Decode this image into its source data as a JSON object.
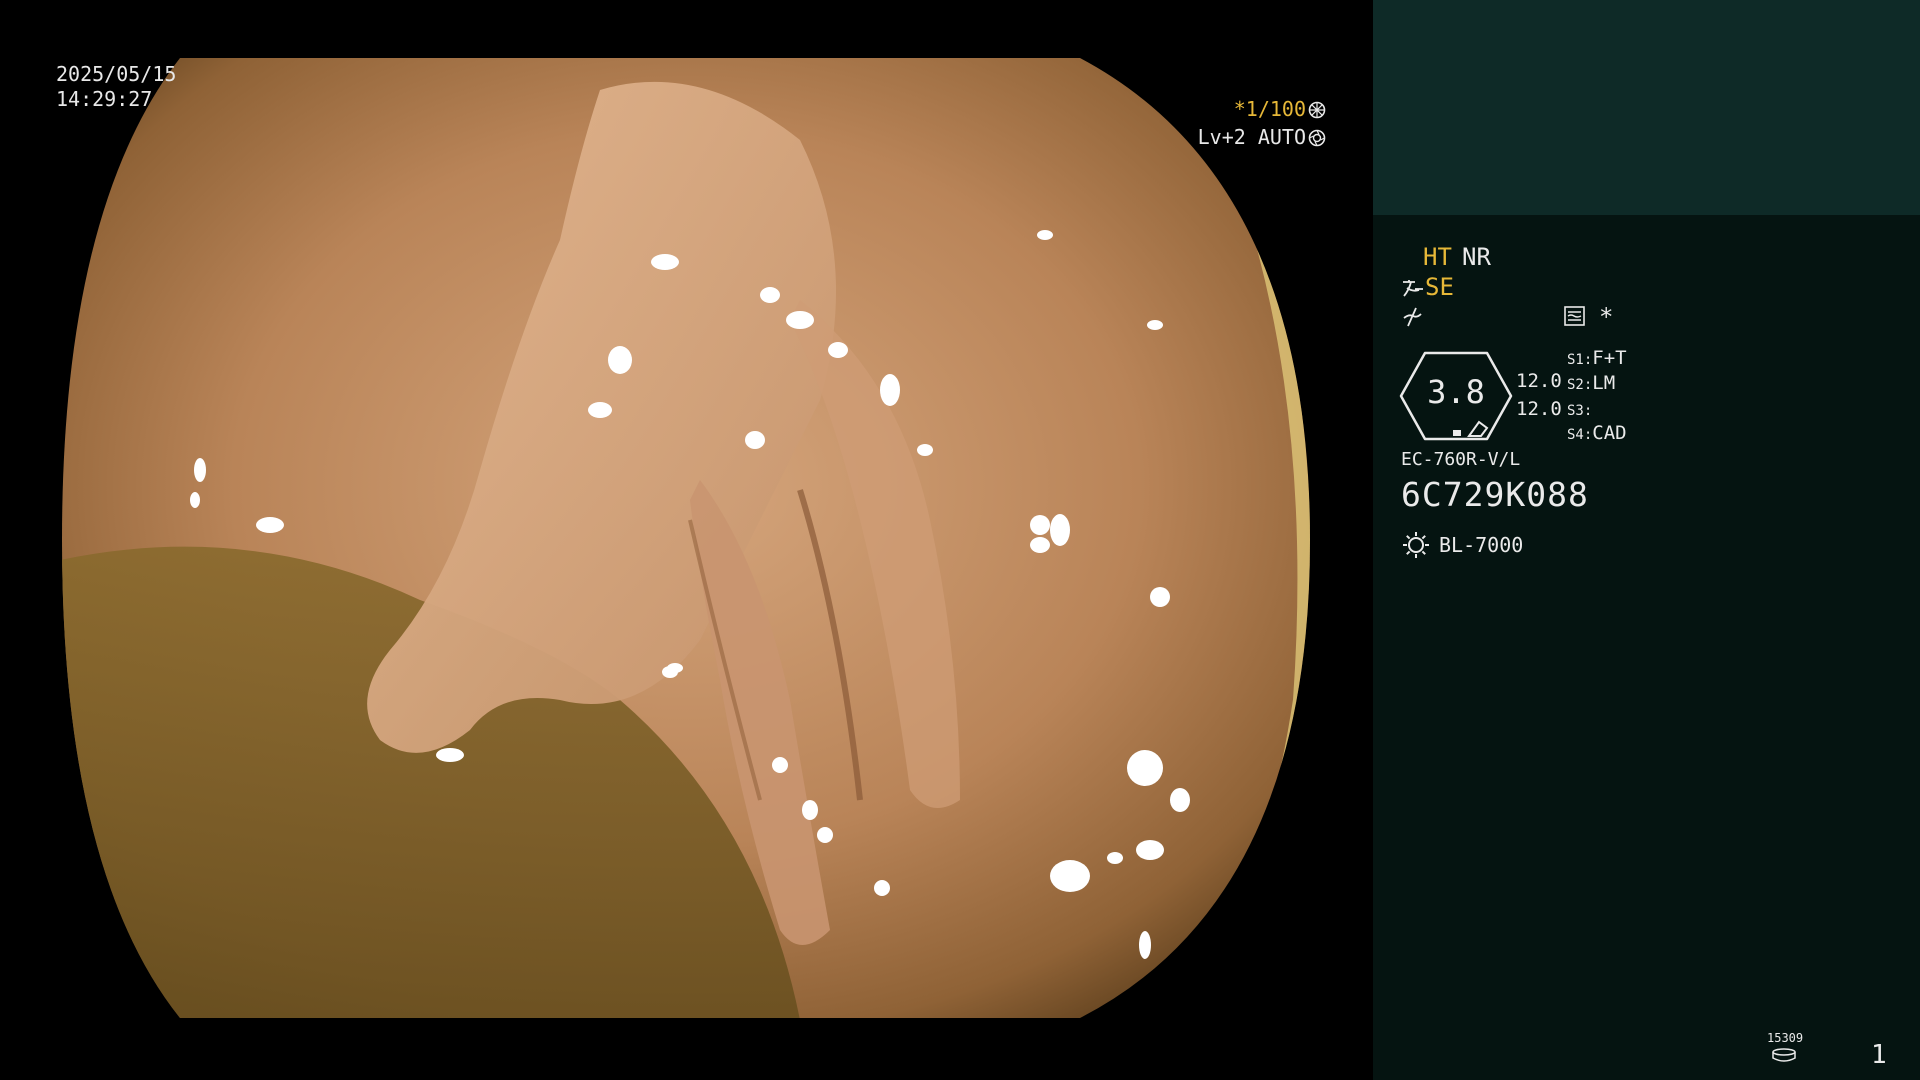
{
  "overlay": {
    "date": "2025/05/15",
    "time": "14:29:27",
    "shutter": {
      "label": "*1/100",
      "icon": "shutter-icon"
    },
    "level": {
      "label": "Lv+2 AUTO",
      "icon": "iris-icon"
    }
  },
  "panel": {
    "modes": {
      "ht": "HT",
      "nr": "NR",
      "se": "SE"
    },
    "icons": {
      "se": "structure-enhance-icon",
      "freeze": "freeze-icon",
      "record": "record-icon"
    },
    "star": "*",
    "gauge": {
      "value": "3.8",
      "top": "12.0",
      "bottom": "12.0"
    },
    "slots": [
      {
        "key": "S1:",
        "value": "F+T"
      },
      {
        "key": "S2:",
        "value": "LM"
      },
      {
        "key": "S3:",
        "value": ""
      },
      {
        "key": "S4:",
        "value": "CAD"
      }
    ],
    "scope_model": "EC-760R-V/L",
    "scope_serial": "6C729K088",
    "light_source": "BL-7000",
    "footer": {
      "counter": "15309",
      "page": "1"
    }
  },
  "colors": {
    "accent": "#e7b838",
    "panel_bg": "#051411",
    "panel_header": "#0e2a27",
    "text": "#eaeaea"
  }
}
